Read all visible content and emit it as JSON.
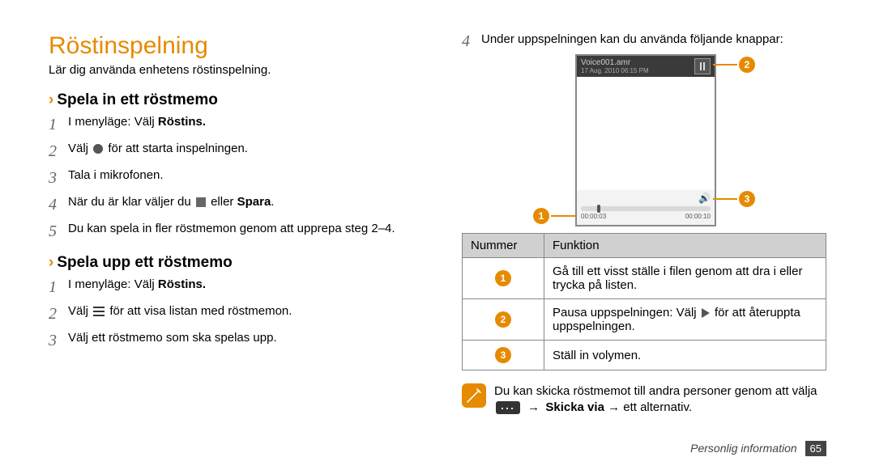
{
  "left": {
    "title": "Röstinspelning",
    "intro": "Lär dig använda enhetens röstinspelning.",
    "section_record": {
      "heading": "Spela in ett röstmemo",
      "steps": {
        "s1a": "I menyläge: Välj ",
        "s1b": "Röstins.",
        "s2a": "Välj ",
        "s2b": " för att starta inspelningen.",
        "s3": "Tala i mikrofonen.",
        "s4a": "När du är klar väljer du ",
        "s4b": " eller ",
        "s4c": "Spara",
        "s4d": ".",
        "s5": "Du kan spela in fler röstmemon genom att upprepa steg 2–4."
      }
    },
    "section_play": {
      "heading": "Spela upp ett röstmemo",
      "steps": {
        "s1a": "I menyläge: Välj ",
        "s1b": "Röstins.",
        "s2a": "Välj ",
        "s2b": " för att visa listan med röstmemon.",
        "s3": "Välj ett röstmemo som ska spelas upp."
      }
    }
  },
  "right": {
    "lead_num": "4",
    "lead_text": "Under uppspelningen kan du använda följande knappar:",
    "phone": {
      "filename": "Voice001.amr",
      "datetime": "17 Aug. 2010 06:15 PM",
      "time_elapsed": "00:00:03",
      "time_total": "00:00:10"
    },
    "table": {
      "h1": "Nummer",
      "h2": "Funktion",
      "r1": "Gå till ett visst ställe i filen genom att dra i eller trycka på listen.",
      "r2a": "Pausa uppspelningen: Välj ",
      "r2b": " för att återuppta uppspelningen.",
      "r3": "Ställ in volymen."
    },
    "note_a": "Du kan skicka röstmemot till andra personer genom att välja ",
    "note_b": "Skicka via",
    "note_c": " → ett alternativ."
  },
  "footer": {
    "section": "Personlig information",
    "page": "65"
  }
}
